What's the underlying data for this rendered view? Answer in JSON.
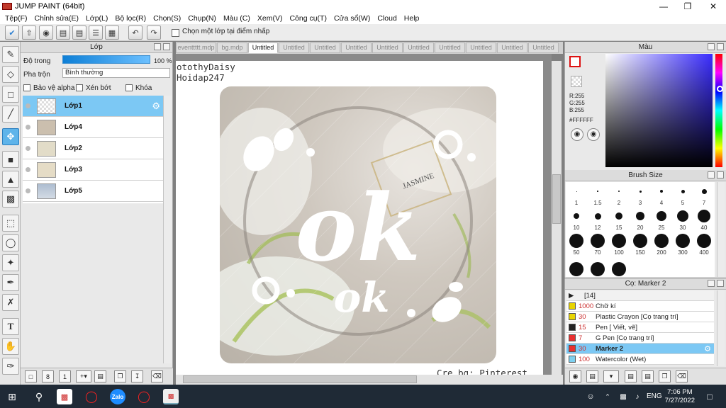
{
  "window": {
    "title": "JUMP PAINT (64bit)"
  },
  "menu": [
    "Tệp(F)",
    "Chỉnh sửa(E)",
    "Lớp(L)",
    "Bộ lọc(R)",
    "Chọn(S)",
    "Chụp(N)",
    "Màu (C)",
    "Xem(V)",
    "Công cụ(T)",
    "Cửa sổ(W)",
    "Cloud",
    "Help"
  ],
  "toolbar": {
    "snap_label": "Chọn một lớp tại điểm nhấp"
  },
  "layer_panel": {
    "title": "Lớp",
    "opacity_label": "Độ trong",
    "opacity_value": "100 %",
    "opacity_fraction": 1.0,
    "blend_label": "Pha trộn",
    "blend_value": "Bình thường",
    "opt_alpha": "Bảo vệ alpha",
    "opt_clip": "Xén bớt",
    "opt_lock": "Khóa",
    "layers": [
      {
        "name": "Lớp1",
        "selected": true
      },
      {
        "name": "Lớp4",
        "selected": false
      },
      {
        "name": "Lớp2",
        "selected": false
      },
      {
        "name": "Lớp3",
        "selected": false
      },
      {
        "name": "Lớp5",
        "selected": false
      }
    ]
  },
  "tabs": [
    "eventtttt.mdp",
    "bg.mdp",
    "Untitled",
    "Untitled",
    "Untitled",
    "Untitled",
    "Untitled",
    "Untitled",
    "Untitled",
    "Untitled",
    "Untitled",
    "Untitled"
  ],
  "canvas": {
    "line1": "otothyDaisy",
    "line2": "Hoidap247",
    "credit": "Cre bg: Pinterest",
    "big_text": "ok",
    "small_text": "ok",
    "brand": "JASMINE"
  },
  "color_panel": {
    "title": "Màu",
    "r": "R:255",
    "g": "G:255",
    "b": "B:255",
    "hex": "#FFFFFF",
    "current_color": "#ffffff"
  },
  "brush_size": {
    "title": "Brush Size",
    "sizes": [
      "1",
      "1.5",
      "2",
      "3",
      "4",
      "5",
      "7",
      "10",
      "12",
      "15",
      "20",
      "25",
      "30",
      "40",
      "50",
      "70",
      "100",
      "150",
      "200",
      "300",
      "400"
    ]
  },
  "brush_panel": {
    "title": "Cọ: Marker 2",
    "header": "[14]",
    "items": [
      {
        "size": "1000",
        "name": "Chữ kí",
        "color": "#e8d400",
        "selected": false
      },
      {
        "size": "30",
        "name": "Plastic Crayon [Cọ trang trí]",
        "color": "#e8d400",
        "selected": false
      },
      {
        "size": "15",
        "name": "Pen [ Viết, vẽ]",
        "color": "#222222",
        "selected": false
      },
      {
        "size": "7",
        "name": "G Pen [Cọ trang trí]",
        "color": "#e83030",
        "selected": false
      },
      {
        "size": "30",
        "name": "Marker 2",
        "color": "#e83030",
        "selected": true
      },
      {
        "size": "100",
        "name": "Watercolor (Wet)",
        "color": "#7dd0f0",
        "selected": false
      }
    ]
  },
  "taskbar": {
    "lang": "ENG",
    "time": "7:06 PM",
    "date": "7/27/2022",
    "zalo": "Zalo"
  }
}
